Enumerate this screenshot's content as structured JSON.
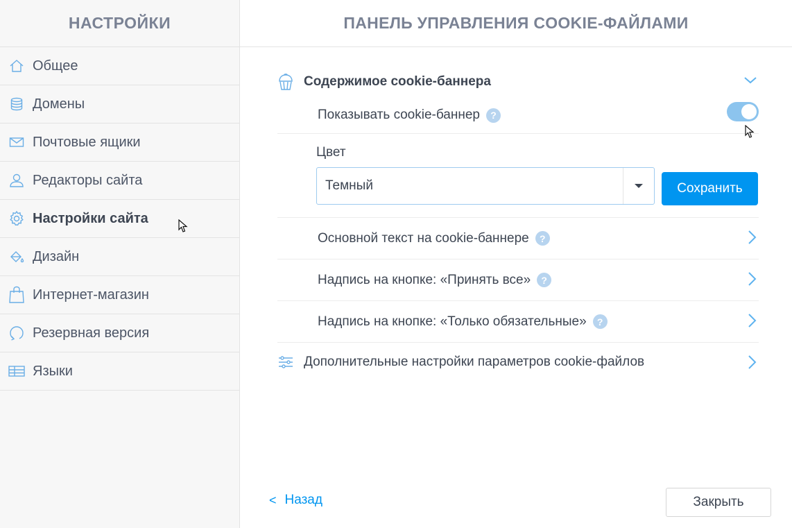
{
  "sidebar": {
    "title": "НАСТРОЙКИ",
    "items": [
      {
        "label": "Общее",
        "icon": "home-icon"
      },
      {
        "label": "Домены",
        "icon": "database-icon"
      },
      {
        "label": "Почтовые ящики",
        "icon": "mail-icon"
      },
      {
        "label": "Редакторы сайта",
        "icon": "user-icon"
      },
      {
        "label": "Настройки сайта",
        "icon": "gear-icon",
        "active": true
      },
      {
        "label": "Дизайн",
        "icon": "paint-bucket-icon"
      },
      {
        "label": "Интернет-магазин",
        "icon": "shopping-bag-icon"
      },
      {
        "label": "Резервная версия",
        "icon": "refresh-icon"
      },
      {
        "label": "Языки",
        "icon": "table-icon"
      }
    ]
  },
  "main": {
    "title": "ПАНЕЛЬ УПРАВЛЕНИЯ COOKIE-ФАЙЛАМИ",
    "section": {
      "title": "Содержимое cookie-баннера",
      "icon": "cupcake-icon",
      "show_banner_label": "Показывать cookie-баннер",
      "show_banner_enabled": true,
      "color_label": "Цвет",
      "color_value": "Темный",
      "save_label": "Сохранить",
      "rows": [
        {
          "label": "Основной текст на cookie-баннере"
        },
        {
          "label": "Надпись на кнопке: «Принять все»"
        },
        {
          "label": "Надпись на кнопке: «Только обязательные»"
        }
      ]
    },
    "advanced_label": "Дополнительные настройки параметров cookie-файлов",
    "help_glyph": "?",
    "back_label": "Назад",
    "back_glyph": "<",
    "close_label": "Закрыть"
  },
  "colors": {
    "accent": "#0095f0",
    "toggle_on": "#8cc4ee",
    "icon": "#6aaee6",
    "help": "#b7d4ef"
  }
}
